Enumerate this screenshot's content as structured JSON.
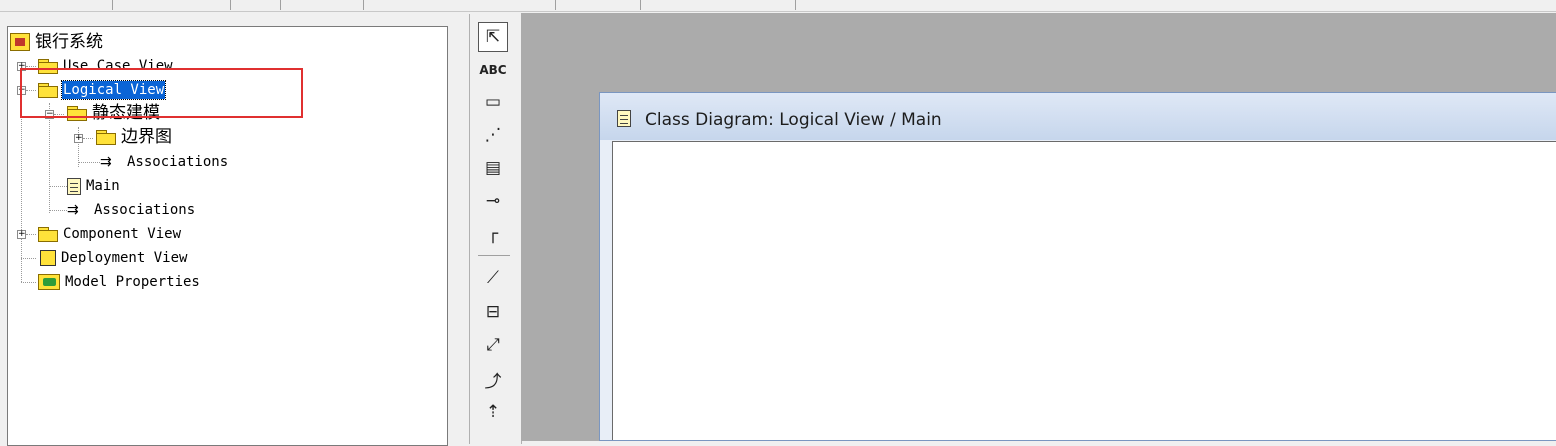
{
  "browser": {
    "root_label": "银行系统",
    "items": [
      {
        "label": "Use Case View"
      },
      {
        "label": "Logical View"
      },
      {
        "label": "静态建模"
      },
      {
        "label": "边界图"
      },
      {
        "label": "Associations"
      },
      {
        "label": "Main"
      },
      {
        "label": "Associations"
      },
      {
        "label": "Component View"
      },
      {
        "label": "Deployment View"
      },
      {
        "label": "Model Properties"
      }
    ],
    "selected": "Logical View"
  },
  "toolbox": {
    "tools": [
      {
        "icon": "select-arrow-icon",
        "glyph": "⇱"
      },
      {
        "icon": "text-icon",
        "glyph": "ABC"
      },
      {
        "icon": "note-icon",
        "glyph": "▭"
      },
      {
        "icon": "anchor-note-icon",
        "glyph": "⋰"
      },
      {
        "icon": "class-icon",
        "glyph": "▤"
      },
      {
        "icon": "interface-icon",
        "glyph": "⊸"
      },
      {
        "icon": "association-icon",
        "glyph": "┌"
      },
      {
        "icon": "aggregation-icon",
        "glyph": "⟋"
      },
      {
        "icon": "package-icon",
        "glyph": "⊟"
      },
      {
        "icon": "dependency-icon",
        "glyph": "⤢"
      },
      {
        "icon": "generalization-icon",
        "glyph": "⤴"
      },
      {
        "icon": "realize-icon",
        "glyph": "⇡"
      }
    ]
  },
  "diagram": {
    "title": "Class Diagram: Logical View / Main"
  },
  "colors": {
    "selection": "#0a64d6",
    "highlight_box": "#e03030",
    "workspace": "#ababab",
    "folder": "#ffe23a"
  }
}
